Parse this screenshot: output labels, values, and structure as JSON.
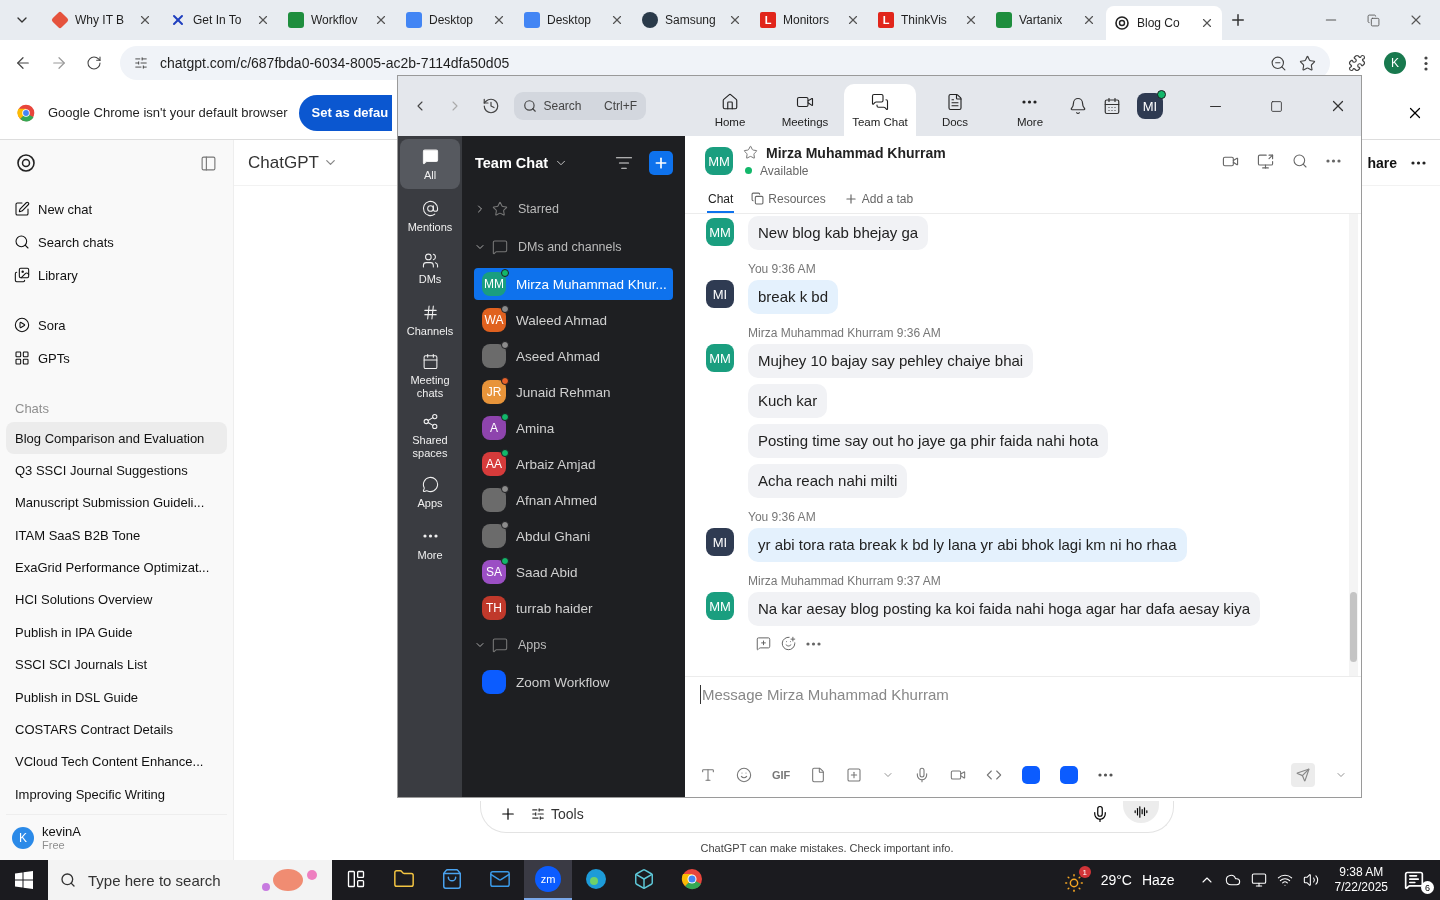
{
  "browser": {
    "tabs": [
      {
        "title": "Why IT B",
        "kind": "diamond",
        "selected": false
      },
      {
        "title": "Get In To",
        "kind": "cross",
        "selected": false
      },
      {
        "title": "Workflov",
        "kind": "sheet",
        "selected": false
      },
      {
        "title": "Desktop",
        "kind": "doc",
        "selected": false
      },
      {
        "title": "Desktop",
        "kind": "doc",
        "selected": false
      },
      {
        "title": "Samsung",
        "kind": "round",
        "selected": false
      },
      {
        "title": "Monitors",
        "kind": "letter",
        "letter": "L",
        "selected": false
      },
      {
        "title": "ThinkVis",
        "kind": "letter",
        "letter": "L",
        "selected": false
      },
      {
        "title": "Vartanix",
        "kind": "sheet",
        "selected": false
      },
      {
        "title": "Blog Co",
        "kind": "knot",
        "selected": true
      }
    ],
    "address": "chatgpt.com/c/687fbda0-6034-8005-ac2b-7114dfa50d05",
    "profile_initial": "K",
    "infobar": {
      "message": "Google Chrome isn't your default browser",
      "button": "Set as defau"
    }
  },
  "chatgpt": {
    "nav": [
      {
        "label": "New chat",
        "kind": "pen"
      },
      {
        "label": "Search chats",
        "kind": "search"
      },
      {
        "label": "Library",
        "kind": "library"
      }
    ],
    "tools": [
      {
        "label": "Sora",
        "kind": "play"
      },
      {
        "label": "GPTs",
        "kind": "grid"
      }
    ],
    "chats_heading": "Chats",
    "chats": [
      {
        "title": "Blog Comparison and Evaluation",
        "selected": true
      },
      {
        "title": "Q3 SSCI Journal Suggestions",
        "selected": false
      },
      {
        "title": "Manuscript Submission Guideli...",
        "selected": false
      },
      {
        "title": "ITAM SaaS B2B Tone",
        "selected": false
      },
      {
        "title": "ExaGrid Performance Optimizat...",
        "selected": false
      },
      {
        "title": "HCI Solutions Overview",
        "selected": false
      },
      {
        "title": "Publish in IPA Guide",
        "selected": false
      },
      {
        "title": "SSCI SCI Journals List",
        "selected": false
      },
      {
        "title": "Publish in DSL Guide",
        "selected": false
      },
      {
        "title": "COSTARS Contract Details",
        "selected": false
      },
      {
        "title": "VCloud Tech Content Enhance...",
        "selected": false
      },
      {
        "title": "Improving Specific Writing",
        "selected": false
      }
    ],
    "user": {
      "initial": "K",
      "name": "kevinA",
      "plan": "Free"
    },
    "model": "ChatGPT",
    "share": "hare",
    "composer_tools": "Tools",
    "disclaimer": "ChatGPT can make mistakes. Check important info."
  },
  "zoom": {
    "search": {
      "placeholder": "Search",
      "shortcut": "Ctrl+F"
    },
    "nav": [
      {
        "label": "Home",
        "kind": "home",
        "selected": false
      },
      {
        "label": "Meetings",
        "kind": "video",
        "selected": false
      },
      {
        "label": "Team Chat",
        "kind": "chat",
        "selected": true
      },
      {
        "label": "Docs",
        "kind": "doc",
        "selected": false
      },
      {
        "label": "More",
        "kind": "more",
        "selected": false
      }
    ],
    "me": {
      "initials": "MI",
      "status": {
        "color": "#12b76a"
      }
    },
    "rail": [
      {
        "label": "All",
        "kind": "all",
        "selected": true
      },
      {
        "label": "Mentions",
        "kind": "at",
        "selected": false
      },
      {
        "label": "DMs",
        "kind": "people",
        "selected": false
      },
      {
        "label": "Channels",
        "kind": "hash",
        "selected": false
      },
      {
        "label": "Meeting chats",
        "kind": "calendar",
        "selected": false
      },
      {
        "label": "Shared spaces",
        "kind": "share",
        "selected": false
      },
      {
        "label": "Apps",
        "kind": "bubble",
        "selected": false
      },
      {
        "label": "More",
        "kind": "more",
        "selected": false
      }
    ],
    "list_title": "Team Chat",
    "sections": [
      {
        "label": "Starred",
        "kind": "star",
        "expanded": false
      },
      {
        "label": "DMs and channels",
        "kind": "bubble",
        "expanded": true,
        "children": [
          {
            "name": "Mirza Muhammad Khur...",
            "kind": "initials",
            "avatar": {
              "initials": "MM",
              "color": "#1a9e7f"
            },
            "status": {
              "color": "#12b76a"
            },
            "selected": true
          },
          {
            "name": "Waleed Ahmad",
            "kind": "initials",
            "avatar": {
              "initials": "WA",
              "color": "#e0611f"
            },
            "status": {
              "color": "#8c8c8c"
            },
            "selected": false
          },
          {
            "name": "Aseed Ahmad",
            "kind": "photo",
            "status": {
              "color": "#8c8c8c"
            },
            "selected": false
          },
          {
            "name": "Junaid Rehman",
            "kind": "initials",
            "avatar": {
              "initials": "JR",
              "color": "#e8943a"
            },
            "status": {
              "color": "#e8622a"
            },
            "selected": false
          },
          {
            "name": "Amina",
            "kind": "initials",
            "avatar": {
              "initials": "A",
              "color": "#8e44ad"
            },
            "status": {
              "color": "#12b76a"
            },
            "selected": false
          },
          {
            "name": "Arbaiz Amjad",
            "kind": "initials",
            "avatar": {
              "initials": "AA",
              "color": "#d63b3b"
            },
            "status": {
              "color": "#12b76a"
            },
            "selected": false
          },
          {
            "name": "Afnan Ahmed",
            "kind": "photo",
            "status": {
              "color": "#8c8c8c"
            },
            "selected": false
          },
          {
            "name": "Abdul Ghani",
            "kind": "photo",
            "status": {
              "color": "#8c8c8c"
            },
            "selected": false
          },
          {
            "name": "Saad Abid",
            "kind": "initials",
            "avatar": {
              "initials": "SA",
              "color": "#9b4fc4"
            },
            "status": {
              "color": "#12b76a"
            },
            "selected": false
          },
          {
            "name": "turrab haider",
            "kind": "initials",
            "avatar": {
              "initials": "TH",
              "color": "#c0392b"
            },
            "selected": false
          }
        ]
      },
      {
        "label": "Apps",
        "kind": "bubble",
        "expanded": true,
        "children": [
          {
            "name": "Zoom Workflow",
            "kind": "app",
            "selected": false
          }
        ]
      }
    ],
    "chat": {
      "initials": "MM",
      "name": "Mirza Muhammad Khurram",
      "status": "Available",
      "tabs": [
        {
          "label": "Chat",
          "kind": "plain",
          "selected": true
        },
        {
          "label": "Resources",
          "kind": "files",
          "selected": false
        },
        {
          "label": "Add a tab",
          "kind": "add",
          "selected": false
        }
      ],
      "groups": [
        {
          "mine": false,
          "initials": "MM",
          "messages": [
            "New blog kab bhejay ga"
          ]
        },
        {
          "mine": true,
          "initials": "MI",
          "sender": "You",
          "time": "9:36 AM",
          "messages": [
            "break k bd"
          ]
        },
        {
          "mine": false,
          "initials": "MM",
          "sender": "Mirza Muhammad Khurram",
          "time": "9:36 AM",
          "messages": [
            "Mujhey 10 bajay say pehley chaiye bhai",
            "Kuch kar",
            "Posting time say out ho jaye ga phir faida nahi hota",
            "Acha reach nahi milti"
          ]
        },
        {
          "mine": true,
          "initials": "MI",
          "sender": "You",
          "time": "9:36 AM",
          "messages": [
            "yr abi tora rata break k bd ly lana yr abi bhok lagi km ni ho rhaa"
          ]
        },
        {
          "mine": false,
          "initials": "MM",
          "sender": "Mirza Muhammad Khurram",
          "time": "9:37 AM",
          "messages": [
            "Na kar aesay blog posting ka koi faida nahi hoga agar har dafa aesay kiya"
          ]
        }
      ],
      "composer": {
        "placeholder": "Message Mirza Muhammad Khurram",
        "gif": "GIF"
      }
    }
  },
  "taskbar": {
    "search_placeholder": "Type here to search",
    "apps": [
      {
        "kind": "taskview",
        "active": false
      },
      {
        "kind": "folder",
        "active": false
      },
      {
        "kind": "store",
        "active": false
      },
      {
        "kind": "mail",
        "active": false
      },
      {
        "kind": "zoom",
        "label": "zm",
        "active": true
      },
      {
        "kind": "edge",
        "active": false
      },
      {
        "kind": "cube",
        "active": false
      },
      {
        "kind": "chrome",
        "active": false
      }
    ],
    "weather_badge": "1",
    "temperature": "29°C",
    "condition": "Haze",
    "time": "9:38 AM",
    "date": "7/22/2025",
    "notifications": "6"
  }
}
